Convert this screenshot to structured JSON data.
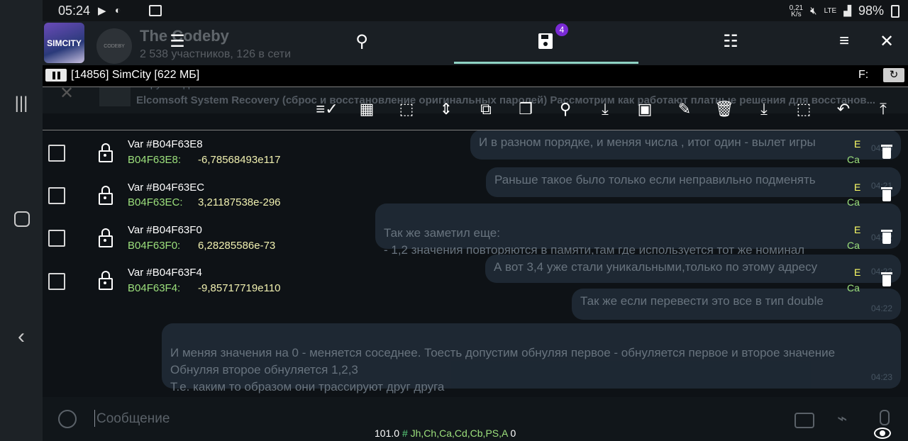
{
  "status_bar": {
    "time": "05:24",
    "net_speed": "0,21\nK/s",
    "network": "LTE",
    "battery": "98%"
  },
  "telegram": {
    "chat_title": "The Codeby",
    "chat_subtitle": "2 538 участников, 126 в сети",
    "avatar_text": "CODEBY",
    "pinned_title": "Форум Кодебай",
    "pinned_text": "Elcomsoft System Recovery (сброс и восстановление оригинальных паролей) Рассмотрим как работают платные решения для восстанов...",
    "input_placeholder": "Сообщение",
    "messages": [
      {
        "text": "И в разном порядке, и меняя числа , итог один - вылет игры",
        "time": "04:20"
      },
      {
        "text": "Раньше такое было только если неправильно подменять",
        "time": "04:21"
      },
      {
        "text": "Так же заметил еще:\n- 1,2 значения повторяются в памяти,там где используется тот же номинал",
        "time": "04:22"
      },
      {
        "text": "А вот 3,4 уже стали уникальными,только по этому адресу",
        "time": "04:22"
      },
      {
        "text": "Так же если перевести это все в тип double",
        "time": "04:22"
      },
      {
        "text": "И меняя значения на 0 - меняется соседнее. Тоесть допустим обнуляя первое - обнуляется первое и второе значение\nОбнуляя второе обнуляется 1,2,3\nТ.е. каким то образом они трассируют друг друга",
        "time": "04:23"
      }
    ]
  },
  "gg": {
    "app_icon_text": "SIMCITY",
    "saved_badge": "4",
    "process_label": "[14856] SimCity [622 МБ]",
    "f_label": "F:",
    "rows": [
      {
        "name": "Var #B04F63E8",
        "address": "B04F63E8:",
        "value": "-6,78568493e117",
        "flag_e": "E",
        "flag_ca": "Ca"
      },
      {
        "name": "Var #B04F63EC",
        "address": "B04F63EC:",
        "value": "3,21187538e-296",
        "flag_e": "E",
        "flag_ca": "Ca"
      },
      {
        "name": "Var #B04F63F0",
        "address": "B04F63F0:",
        "value": "6,28285586e-73",
        "flag_e": "E",
        "flag_ca": "Ca"
      },
      {
        "name": "Var #B04F63F4",
        "address": "B04F63F4:",
        "value": "-9,85717719e110",
        "flag_e": "E",
        "flag_ca": "Ca"
      }
    ],
    "bottom": {
      "speed": "101.0",
      "hash": "#",
      "regions": "Jh,Ch,Ca,Cd,Cb,PS,A",
      "count": "0"
    }
  }
}
